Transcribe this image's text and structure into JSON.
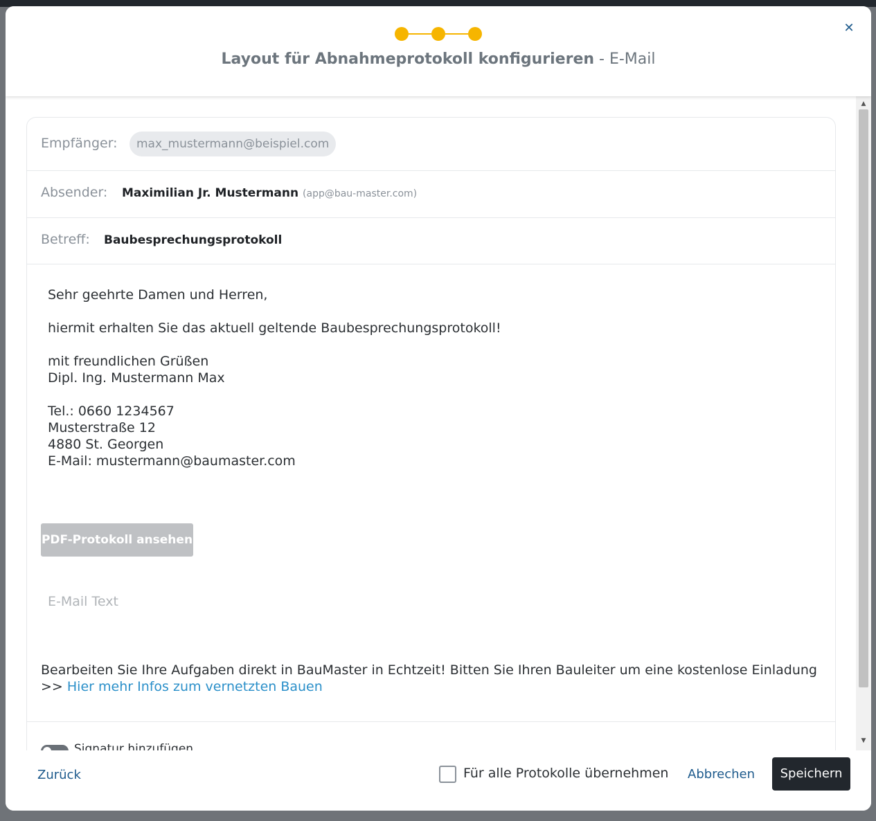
{
  "header": {
    "title_bold": "Layout für Abnahmeprotokoll konfigurieren",
    "title_separator": " - ",
    "title_step": "E-Mail",
    "stepper": {
      "total_steps": 3,
      "current_step": 3,
      "color": "#f6b500"
    },
    "close_icon": "close-icon"
  },
  "email": {
    "recipient_label": "Empfänger:",
    "recipient_value": "max_mustermann@beispiel.com",
    "sender_label": "Absender:",
    "sender_name": "Maximilian Jr. Mustermann",
    "sender_email": "(app@bau-master.com)",
    "subject_label": "Betreff:",
    "subject_value": "Baubesprechungsprotokoll",
    "body": "Sehr geehrte Damen und Herren,\n\nhiermit erhalten Sie das aktuell geltende Baubesprechungsprotokoll!\n\nmit freundlichen Grüßen\nDipl. Ing. Mustermann Max\n\nTel.: 0660 1234567\nMusterstraße 12\n4880 St. Georgen\nE-Mail: mustermann@baumaster.com",
    "pdf_button_label": "PDF-Protokoll ansehen",
    "email_text_placeholder": "E-Mail Text",
    "promo_text": "Bearbeiten Sie Ihre Aufgaben direkt in BauMaster in Echtzeit! Bitten Sie Ihren Bauleiter um eine kostenlose Einladung",
    "promo_prefix": ">> ",
    "promo_link": "Hier mehr Infos zum vernetzten Bauen",
    "toggle_label": "Signatur hinzufügen"
  },
  "footer": {
    "back_label": "Zurück",
    "apply_all_label": "Für alle Protokolle übernehmen",
    "apply_all_checked": false,
    "cancel_label": "Abbrechen",
    "save_label": "Speichern"
  },
  "colors": {
    "accent": "#f6b500",
    "link": "#1d5a8c",
    "primary_button": "#22272d",
    "disabled_button": "#bfc1c4"
  }
}
